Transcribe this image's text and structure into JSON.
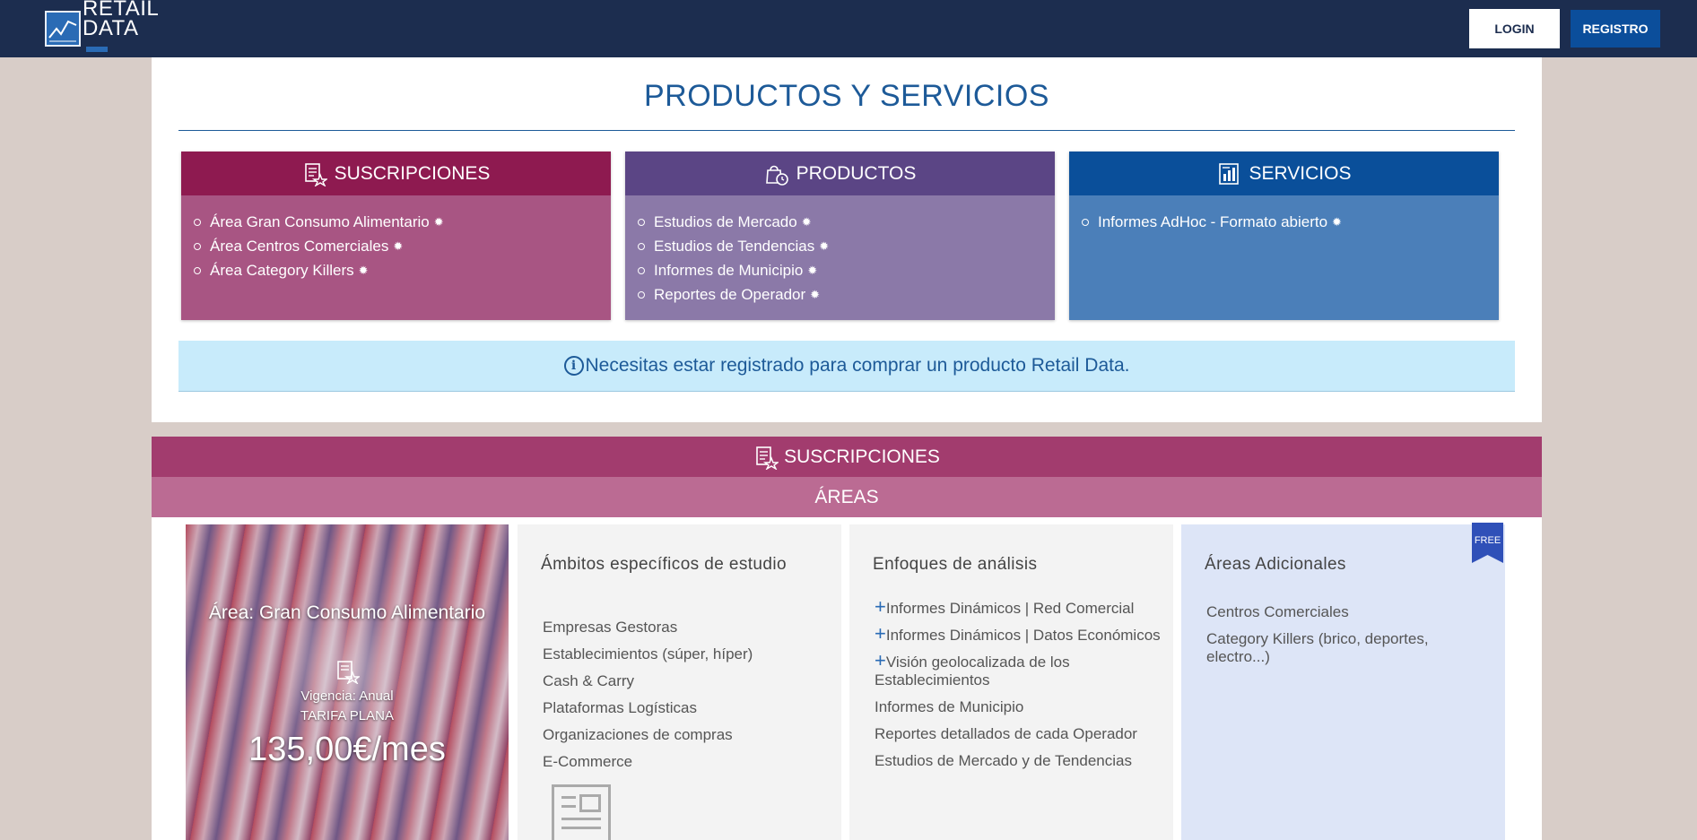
{
  "header": {
    "logo_line1": "RETAIL",
    "logo_line2": "DATA",
    "login_label": "LOGIN",
    "registro_label": "REGISTRO"
  },
  "page": {
    "title": "PRODUCTOS Y SERVICIOS"
  },
  "cards": {
    "suscripciones": {
      "title": "SUSCRIPCIONES",
      "icon": "document-star-icon",
      "items": [
        "Área Gran Consumo Alimentario",
        "Área Centros Comerciales",
        "Área Category Killers"
      ]
    },
    "productos": {
      "title": "PRODUCTOS",
      "icon": "bag-clock-icon",
      "items": [
        "Estudios de Mercado",
        "Estudios de Tendencias",
        "Informes de Municipio",
        "Reportes de Operador"
      ]
    },
    "servicios": {
      "title": "SERVICIOS",
      "icon": "report-chart-icon",
      "items": [
        "Informes AdHoc - Formato abierto"
      ]
    }
  },
  "notice": {
    "text": "Necesitas estar registrado para comprar un producto Retail Data."
  },
  "section": {
    "title": "SUSCRIPCIONES",
    "subtitle": "ÁREAS"
  },
  "area": {
    "title": "Área: Gran Consumo Alimentario",
    "vigencia": "Vigencia: Anual",
    "tarifa": "TARIFA PLANA",
    "price": "135,00€/mes"
  },
  "ambitos": {
    "title": "Ámbitos específicos de estudio",
    "items": [
      "Empresas Gestoras",
      "Establecimientos (súper, híper)",
      "Cash & Carry",
      "Plataformas Logísticas",
      "Organizaciones de compras",
      "E-Commerce"
    ]
  },
  "enfoques": {
    "title": "Enfoques de análisis",
    "plus_items": [
      "Informes Dinámicos | Red Comercial",
      "Informes Dinámicos | Datos Económicos",
      "Visión geolocalizada de los Establecimientos"
    ],
    "items": [
      "Informes de Municipio",
      "Reportes detallados de cada Operador",
      "Estudios de Mercado y de Tendencias"
    ]
  },
  "adicionales": {
    "title": "Áreas Adicionales",
    "items": [
      "Centros Comerciales",
      "Category Killers (brico, deportes, electro...)"
    ],
    "badge": "FREE"
  },
  "colors": {
    "header_bg": "#1c2d4f",
    "subs_head": "#8e1a50",
    "prod_head": "#5b4585",
    "serv_head": "#0a4f9a",
    "notice_bg": "#c8ebfb",
    "section_head": "#a23c6e"
  }
}
